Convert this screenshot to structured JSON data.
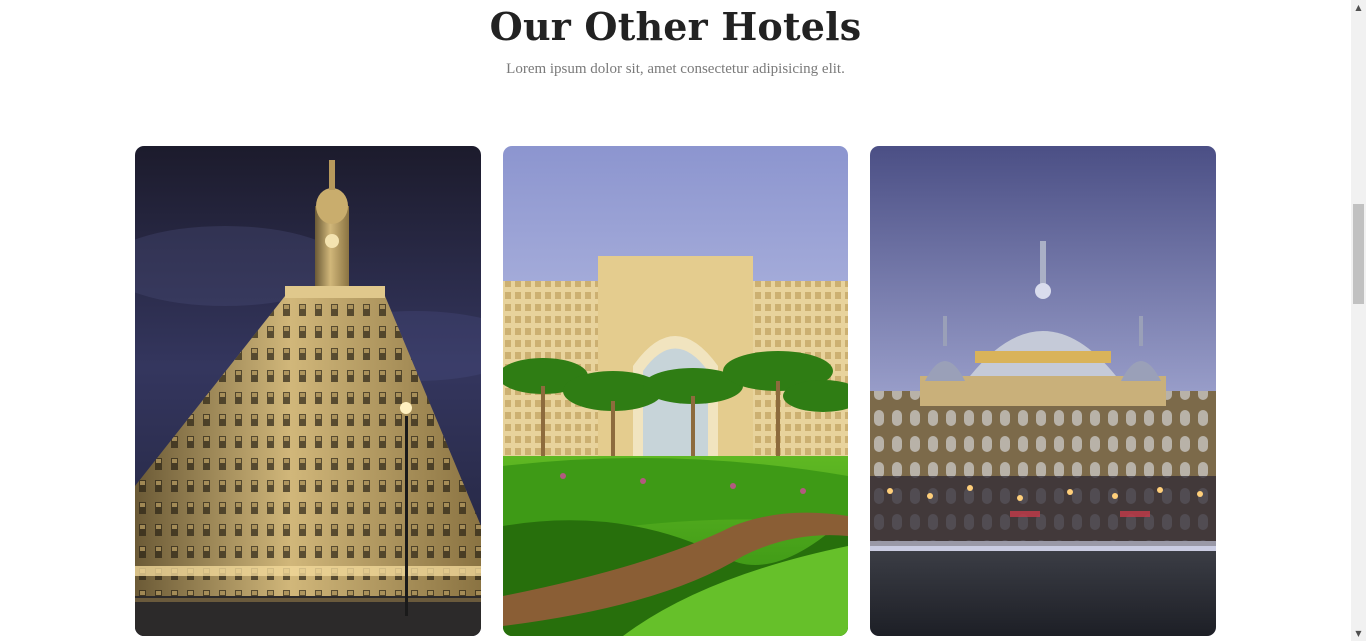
{
  "section": {
    "title": "Our Other Hotels",
    "subtitle": "Lorem ipsum dolor sit, amet consectetur adipisicing elit."
  },
  "hotels": [
    {
      "image": "ornate-corner-building-night"
    },
    {
      "image": "resort-palm-gardens"
    },
    {
      "image": "domed-palace-dusk"
    }
  ],
  "scrollbar": {
    "up_icon": "arrow-up-icon",
    "down_icon": "arrow-down-icon"
  }
}
